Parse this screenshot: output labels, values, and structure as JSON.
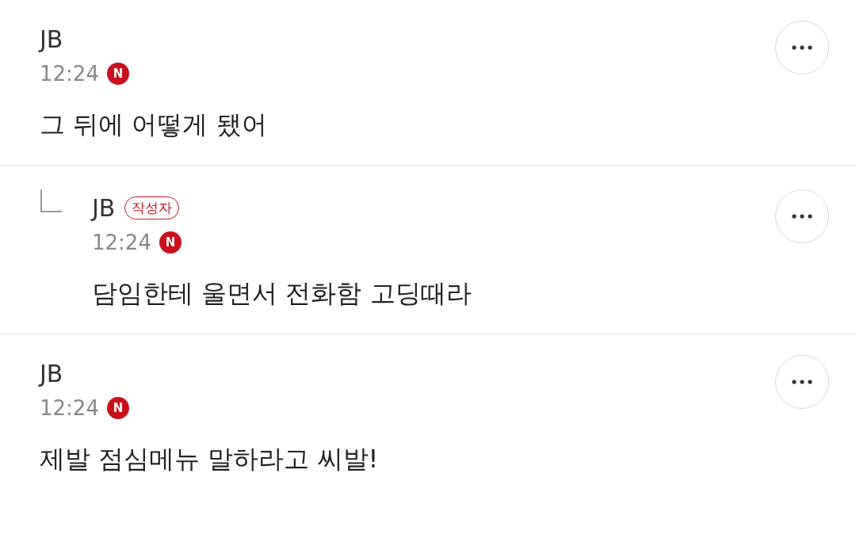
{
  "comments": [
    {
      "kind": "comment",
      "author": "JB",
      "time": "12:24",
      "new_badge": "N",
      "text": "그 뒤에 어떻게 됐어"
    },
    {
      "kind": "reply",
      "author": "JB",
      "author_badge": "작성자",
      "time": "12:24",
      "new_badge": "N",
      "text": "담임한테 울면서 전화함 고딩때라"
    },
    {
      "kind": "comment",
      "author": "JB",
      "time": "12:24",
      "new_badge": "N",
      "text": "제발 점심메뉴 말하라고 씨발!"
    }
  ]
}
